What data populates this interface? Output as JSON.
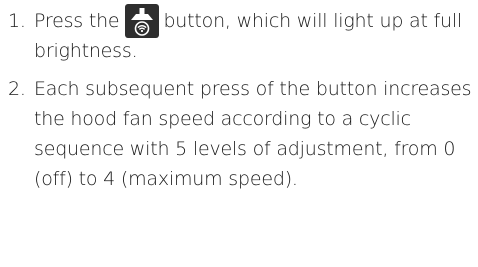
{
  "steps": [
    {
      "number": "1.",
      "text_before": "Press the",
      "icon": "hood-fan-button-icon",
      "text_after": "button, which will light up at full brightness."
    },
    {
      "number": "2.",
      "text": "Each subsequent press of the button increases the hood fan speed according to a cyclic sequence with 5 levels of adjustment, from 0 (off) to 4 (maximum speed)."
    }
  ],
  "colors": {
    "text": "#1a1a1a",
    "icon_background": "#2e2e2e",
    "icon_foreground": "#ffffff"
  }
}
